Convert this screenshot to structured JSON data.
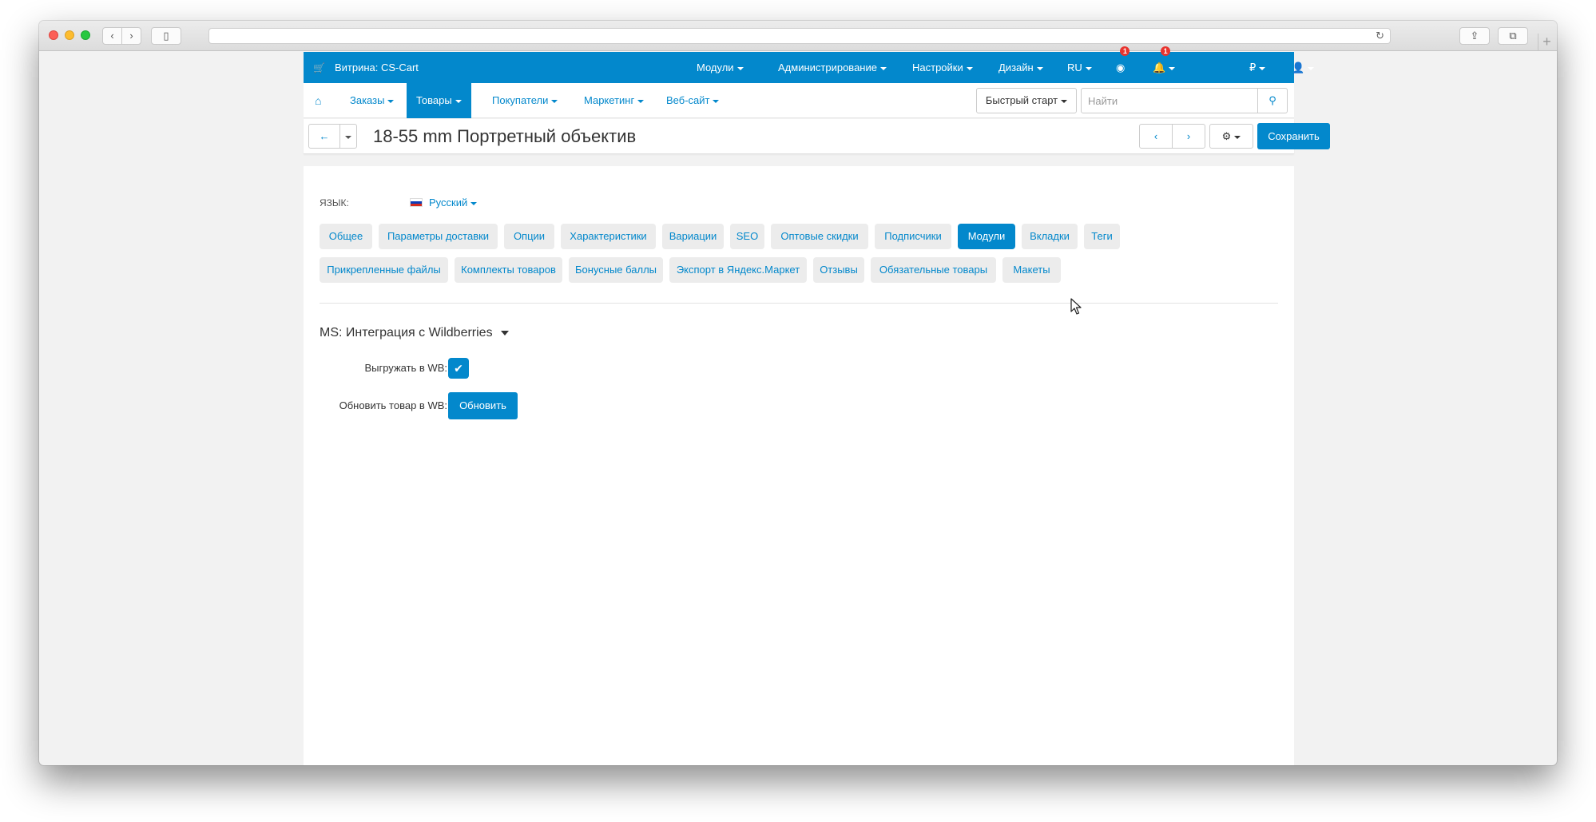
{
  "browser": {
    "address_url": "",
    "icons": {
      "back": "chevron-left-icon",
      "forward": "chevron-right-icon",
      "sidebar": "sidebar-icon",
      "reload": "reload-icon",
      "share": "share-icon",
      "tabs": "tabs-icon",
      "new_tab": "plus-icon"
    }
  },
  "topbar": {
    "storefront": "Витрина: CS-Cart",
    "menu": {
      "modules": "Модули",
      "administration": "Администрирование",
      "settings": "Настройки",
      "design": "Дизайн",
      "language": "RU",
      "currency": "₽"
    },
    "help_badge": "1",
    "notifications_badge": "1",
    "color": "#0388cc"
  },
  "nav": {
    "orders": "Заказы",
    "products": "Товары",
    "customers": "Покупатели",
    "marketing": "Маркетинг",
    "website": "Веб-сайт",
    "quick_start": "Быстрый старт",
    "search_placeholder": "Найти"
  },
  "toolbar": {
    "title": "18-55 mm Портретный объектив",
    "save": "Сохранить"
  },
  "language": {
    "label": "ЯЗЫК:",
    "value": "Русский"
  },
  "tabs": {
    "general": "Общее",
    "shipping": "Параметры доставки",
    "options": "Опции",
    "features": "Характеристики",
    "variations": "Вариации",
    "seo": "SEO",
    "wholesale": "Оптовые скидки",
    "subscribers": "Подписчики",
    "addons": "Модули",
    "tabs": "Вкладки",
    "tags": "Теги",
    "attachments": "Прикрепленные файлы",
    "bundles": "Комплекты товаров",
    "reward_points": "Бонусные баллы",
    "yandex_export": "Экспорт в Яндекс.Маркет",
    "reviews": "Отзывы",
    "required_products": "Обязательные товары",
    "layouts": "Макеты",
    "active": "Модули"
  },
  "module_section": {
    "title": "MS: Интеграция с Wildberries",
    "export_label": "Выгружать в WB:",
    "export_checked": true,
    "update_label": "Обновить товар в WB:",
    "update_button": "Обновить"
  }
}
